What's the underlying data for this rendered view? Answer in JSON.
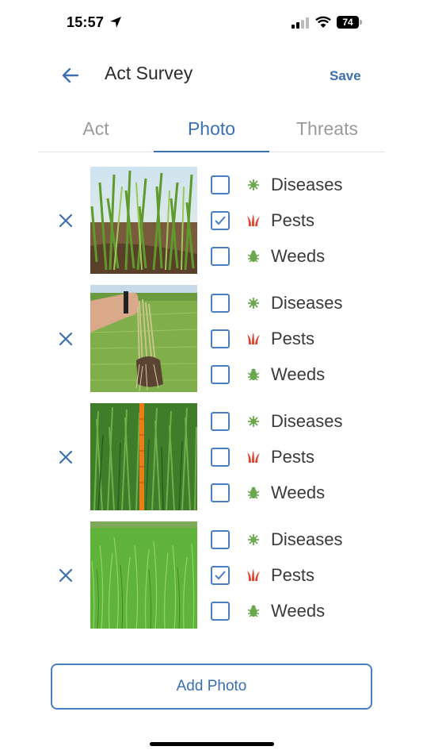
{
  "status_bar": {
    "time": "15:57",
    "battery": "74"
  },
  "header": {
    "title": "Act Survey",
    "save_label": "Save"
  },
  "tabs": [
    {
      "label": "Act",
      "active": false
    },
    {
      "label": "Photo",
      "active": true
    },
    {
      "label": "Threats",
      "active": false
    }
  ],
  "threat_labels": {
    "diseases": "Diseases",
    "pests": "Pests",
    "weeds": "Weeds"
  },
  "photos": [
    {
      "diseases": false,
      "pests": true,
      "weeds": false
    },
    {
      "diseases": false,
      "pests": false,
      "weeds": false
    },
    {
      "diseases": false,
      "pests": false,
      "weeds": false
    },
    {
      "diseases": false,
      "pests": true,
      "weeds": false
    }
  ],
  "icons": {
    "diseases": "virus-icon",
    "pests": "grass-icon",
    "weeds": "bug-icon"
  },
  "colors": {
    "accent": "#3b6fb0",
    "diseases_icon": "#6aa84f",
    "pests_icon": "#e0442f",
    "weeds_icon": "#6aa84f"
  },
  "add_photo_label": "Add Photo"
}
